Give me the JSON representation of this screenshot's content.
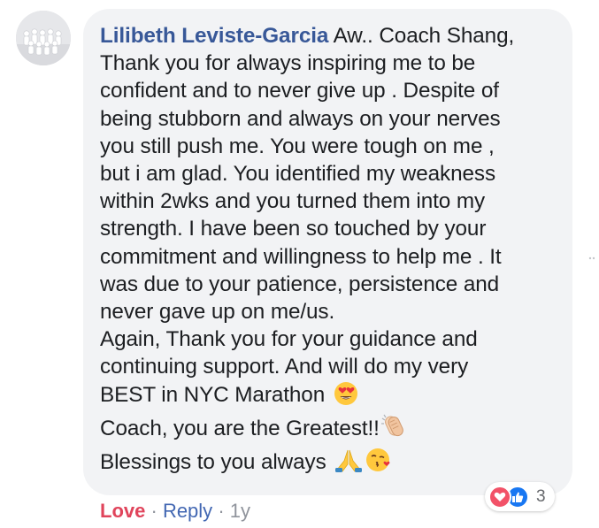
{
  "comment": {
    "author": "Lilibeth Leviste-Garcia",
    "lines": [
      " Aw.. Coach Shang,",
      "Thank you for always inspiring me to be",
      "confident and to never give up . Despite of",
      "being stubborn and always on your nerves",
      "you still push me. You were tough on me ,",
      "but i am glad. You identified my weakness",
      "within 2wks and you turned them into my",
      "strength. I have been so touched by your",
      "commitment and willingness to help me . It",
      "was due to your patience, persistence and",
      "never gave up on me/us.",
      "Again, Thank you for your guidance and",
      "continuing support. And will do my very",
      "BEST in NYC Marathon",
      "Coach, you are the Greatest!!",
      "Blessings to you always"
    ],
    "emojis": {
      "heart_eyes": "heart-eyes-face-icon",
      "clap": "clapping-hands-icon",
      "pray": "folded-hands-icon",
      "kiss": "face-blowing-kiss-icon"
    }
  },
  "reactions": {
    "types": [
      "love-reaction-icon",
      "like-reaction-icon"
    ],
    "count": "3",
    "love_color": "#f25268",
    "like_color": "#1877f2"
  },
  "actions": {
    "love_label": "Love",
    "separator": "·",
    "reply_label": "Reply",
    "time": "1y"
  },
  "colors": {
    "author": "#385898",
    "bubble": "#f2f3f5",
    "love_text": "#e0445b",
    "reply_text": "#4267b2",
    "muted": "#90949c"
  }
}
